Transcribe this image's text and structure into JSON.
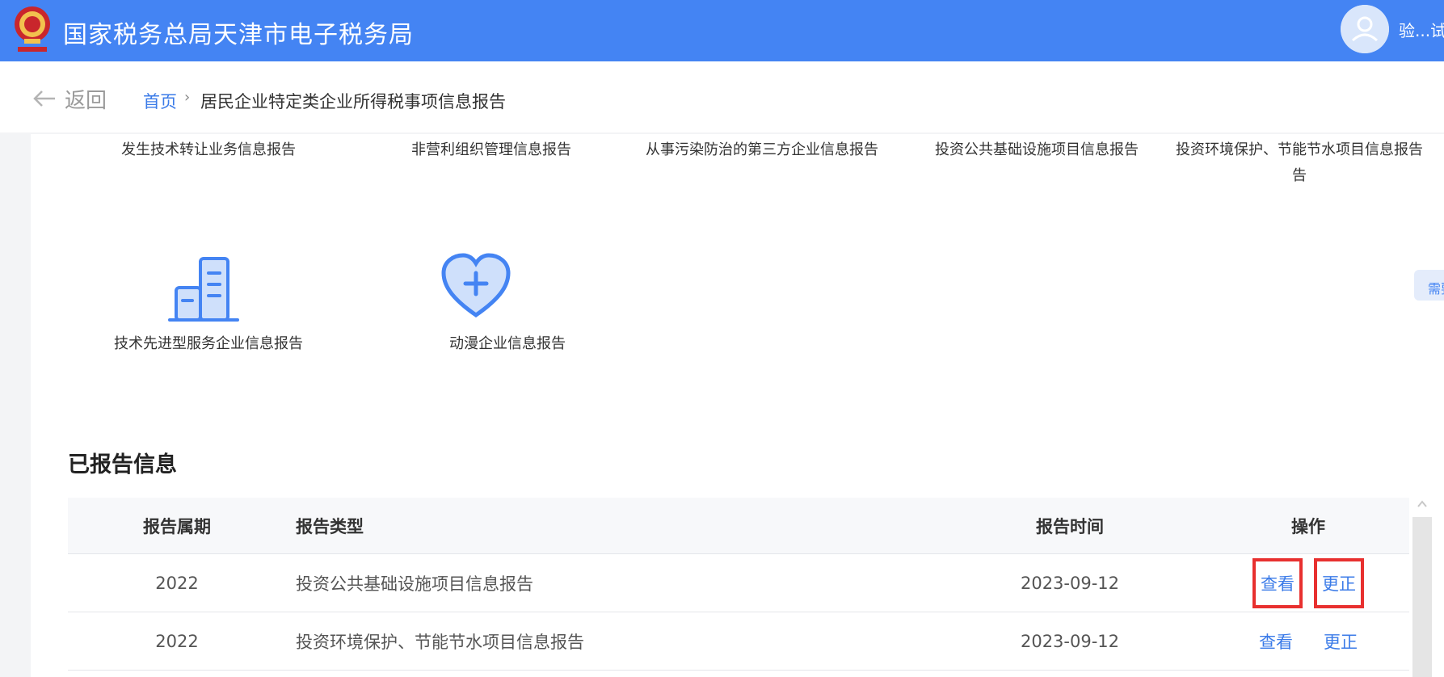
{
  "header": {
    "title": "国家税务总局天津市电子税务局",
    "user_name": "验...试"
  },
  "breadcrumb": {
    "back_label": "返回",
    "home": "首页",
    "separator": "›",
    "current": "居民企业特定类企业所得税事项信息报告"
  },
  "report_types": {
    "row1": [
      "发生技术转让业务信息报告",
      "非营利组织管理信息报告",
      "从事污染防治的第三方企业信息报告",
      "投资公共基础设施项目信息报告",
      "投资环境保护、节能节水项目信息报告"
    ],
    "row1_last_line2": "告",
    "row2": [
      {
        "label": "技术先进型服务企业信息报告",
        "icon": "building-icon"
      },
      {
        "label": "动漫企业信息报告",
        "icon": "heart-plus-icon"
      }
    ]
  },
  "float_tab": {
    "label": "需要"
  },
  "reported_section": {
    "title": "已报告信息",
    "columns": [
      "报告属期",
      "报告类型",
      "报告时间",
      "操作"
    ],
    "rows": [
      {
        "period": "2022",
        "type": "投资公共基础设施项目信息报告",
        "time": "2023-09-12",
        "view": "查看",
        "correct": "更正"
      },
      {
        "period": "2022",
        "type": "投资环境保护、节能节水项目信息报告",
        "time": "2023-09-12",
        "view": "查看",
        "correct": "更正"
      }
    ]
  },
  "colors": {
    "header_bg": "#4484f3",
    "link": "#3b7be8",
    "highlight_box": "#e8302f"
  }
}
